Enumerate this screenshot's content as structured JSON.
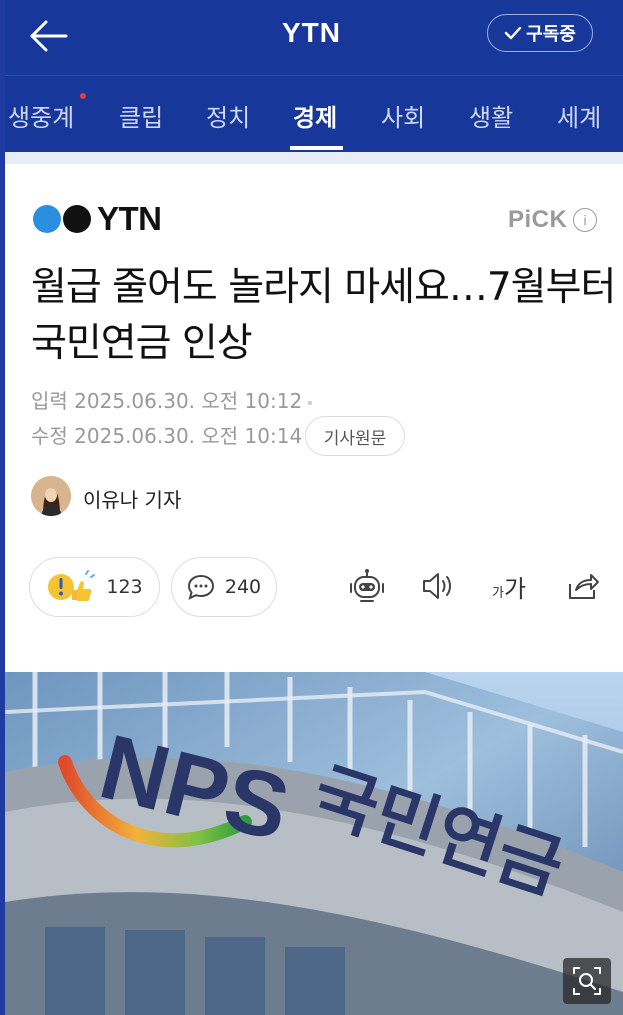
{
  "header": {
    "title": "YTN",
    "subscribe_label": "구독중"
  },
  "tabs": [
    {
      "label": "생중계"
    },
    {
      "label": "클립"
    },
    {
      "label": "정치"
    },
    {
      "label": "경제"
    },
    {
      "label": "사회"
    },
    {
      "label": "생활"
    },
    {
      "label": "세계"
    }
  ],
  "active_tab": "경제",
  "article": {
    "publisher": "YTN",
    "pick_label": "PiCK",
    "headline": "월급 줄어도 놀라지 마세요…7월부터 국민연금 인상",
    "input_label": "입력",
    "input_time": "2025.06.30. 오전 10:12",
    "edit_label": "수정",
    "edit_time": "2025.06.30. 오전 10:14",
    "original_button": "기사원문",
    "reporter": "이유나 기자",
    "reaction_count": "123",
    "comment_count": "240",
    "font_size_label": "가가"
  },
  "photo": {
    "sign_logo": "NPS",
    "sign_text": "국민연금"
  },
  "colors": {
    "brand_blue": "#17389a",
    "logo_blue": "#2b8fe0"
  }
}
